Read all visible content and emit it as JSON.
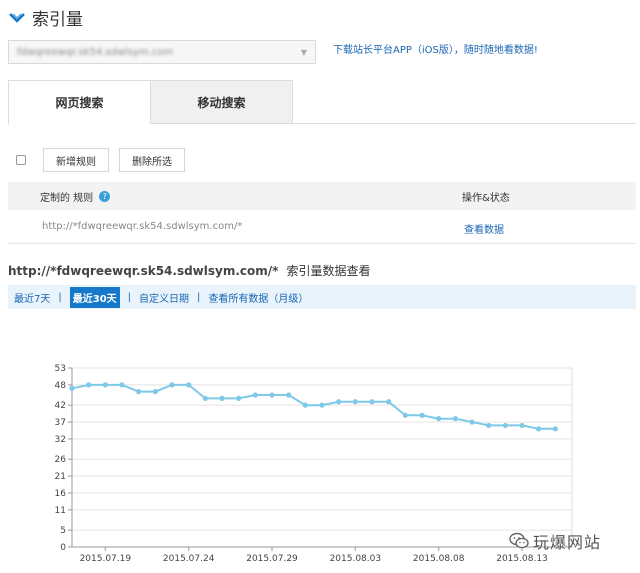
{
  "title": "索引量",
  "site_select": {
    "value": "fdwqreewqr.sk54.sdwlsym.com"
  },
  "app_link": "下载站长平台APP（iOS版），随时随地看数据!",
  "tabs": [
    {
      "label": "网页搜索",
      "active": true
    },
    {
      "label": "移动搜索",
      "active": false
    }
  ],
  "actions": {
    "new_rule": "新增规则",
    "delete_selected": "删除所选"
  },
  "rules_table": {
    "col_rule": "定制的 规则",
    "col_status": "操作&状态",
    "rows": [
      {
        "url": "http://*fdwqreewqr.sk54.sdwlsym.com/*",
        "action": "查看数据"
      }
    ]
  },
  "subtitle": {
    "site": "http://*fdwqreewqr.sk54.sdwlsym.com/*",
    "label": "索引量数据查看"
  },
  "range_options": [
    "最近7天",
    "最近30天",
    "自定义日期",
    "查看所有数据（月级）"
  ],
  "range_active_index": 1,
  "chart_data": {
    "type": "line",
    "x": [
      "2015.07.17",
      "2015.07.18",
      "2015.07.19",
      "2015.07.20",
      "2015.07.21",
      "2015.07.22",
      "2015.07.23",
      "2015.07.24",
      "2015.07.25",
      "2015.07.26",
      "2015.07.27",
      "2015.07.28",
      "2015.07.29",
      "2015.07.30",
      "2015.07.31",
      "2015.08.01",
      "2015.08.02",
      "2015.08.03",
      "2015.08.04",
      "2015.08.05",
      "2015.08.06",
      "2015.08.07",
      "2015.08.08",
      "2015.08.09",
      "2015.08.10",
      "2015.08.11",
      "2015.08.12",
      "2015.08.13",
      "2015.08.14",
      "2015.08.15",
      "2015.08.16"
    ],
    "x_tick_labels": [
      "2015.07.19",
      "2015.07.24",
      "2015.07.29",
      "2015.08.03",
      "2015.08.08",
      "2015.08.13"
    ],
    "series": [
      {
        "values": [
          47,
          48,
          48,
          48,
          46,
          46,
          48,
          48,
          44,
          44,
          44,
          45,
          45,
          45,
          42,
          42,
          43,
          43,
          43,
          43,
          39,
          39,
          38,
          38,
          37,
          36,
          36,
          36,
          35,
          35
        ]
      }
    ],
    "y_ticks": [
      0,
      5,
      11,
      16,
      21,
      26,
      32,
      37,
      42,
      48,
      53
    ],
    "ylim": [
      0,
      53
    ],
    "grid": true,
    "color": "#7ec8e8"
  },
  "watermark": {
    "text": "玩爆网站",
    "icon": "wechat-icon"
  },
  "colors": {
    "accent": "#1678c8",
    "link": "#1a66b3",
    "line": "#7ec8e8"
  }
}
